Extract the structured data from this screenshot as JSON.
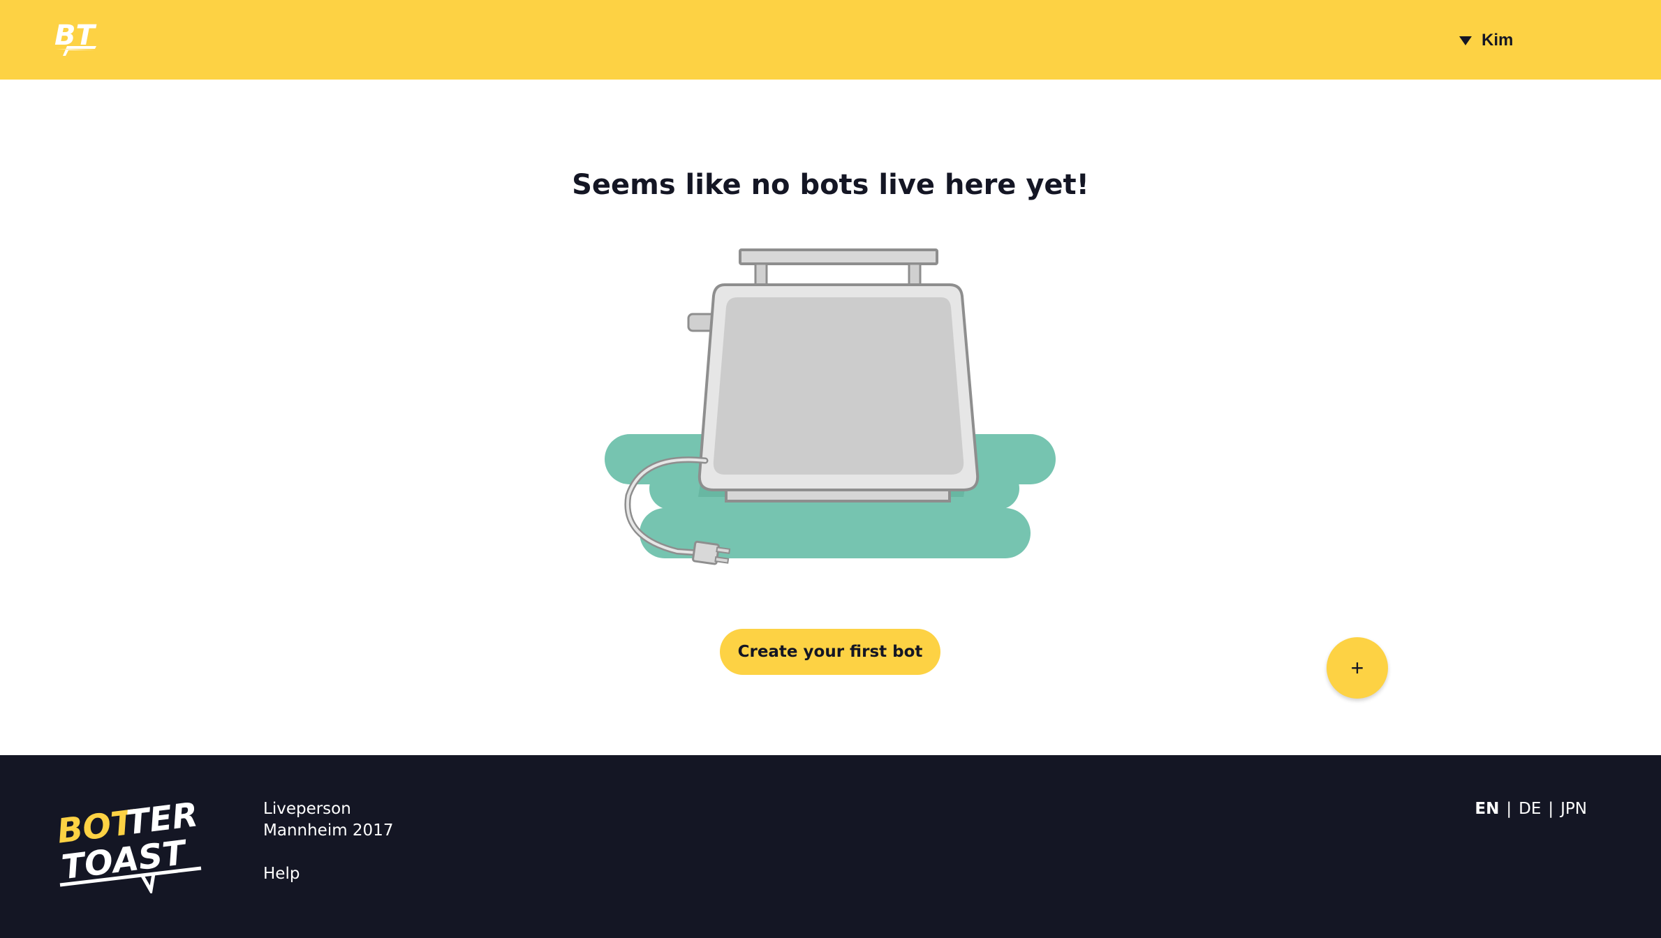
{
  "header": {
    "logo_icon": "bt-logo-icon",
    "user_name": "Kim",
    "user_menu_icon": "caret-down-icon",
    "bg_color": "#FDD244"
  },
  "main": {
    "title": "Seems like no bots live here yet!",
    "illustration_icon": "toaster-illustration",
    "create_button_label": "Create your first bot",
    "fab_label": "+"
  },
  "footer": {
    "brand_top_bot": "BOT",
    "brand_top_ter": "TER",
    "brand_bottom": "TOAST",
    "company": "Liveperson",
    "location": "Mannheim 2017",
    "help": "Help",
    "languages": [
      "EN",
      "DE",
      "JPN"
    ],
    "separator": "|",
    "bg_color": "#141624"
  },
  "colors": {
    "accent": "#FDD244",
    "dark": "#141624",
    "mint": "#76C4B0"
  }
}
